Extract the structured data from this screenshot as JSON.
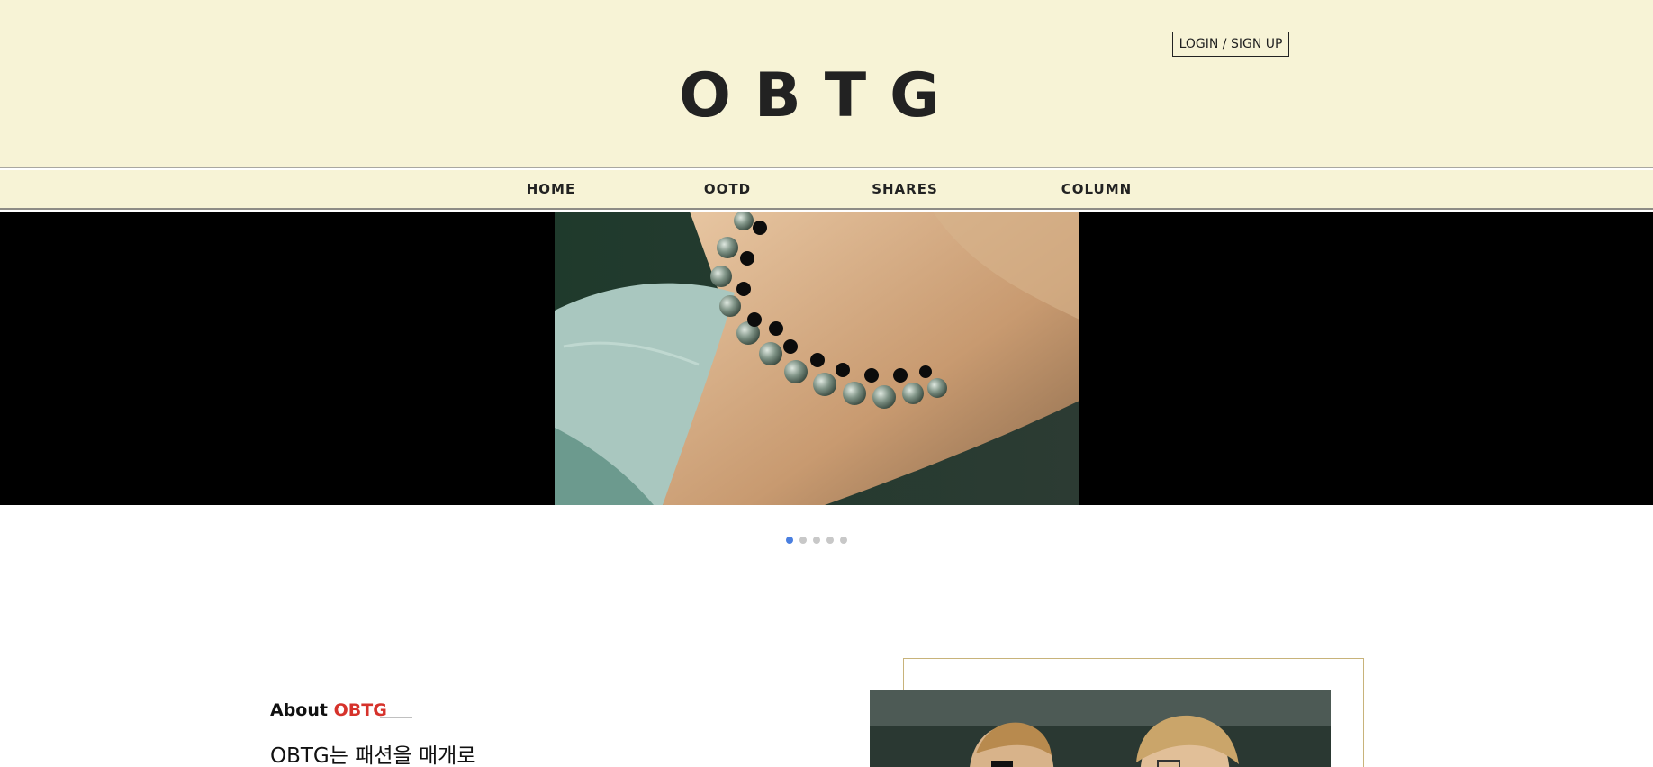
{
  "header": {
    "logo": "OBTG",
    "login_label": "LOGIN / SIGN UP"
  },
  "nav": {
    "items": [
      {
        "label": "HOME"
      },
      {
        "label": "OOTD"
      },
      {
        "label": "SHARES"
      },
      {
        "label": "COLUMN"
      }
    ]
  },
  "hero": {
    "slide_count": 5,
    "active_slide": 1
  },
  "about": {
    "title_prefix": "About",
    "title_accent": "OBTG",
    "description": "OBTG는 패션을 매개로"
  },
  "colors": {
    "header_bg": "#f7f3d6",
    "accent": "#d6322b",
    "dot_active": "#4a7fe0",
    "frame_border": "#c8b37a"
  }
}
